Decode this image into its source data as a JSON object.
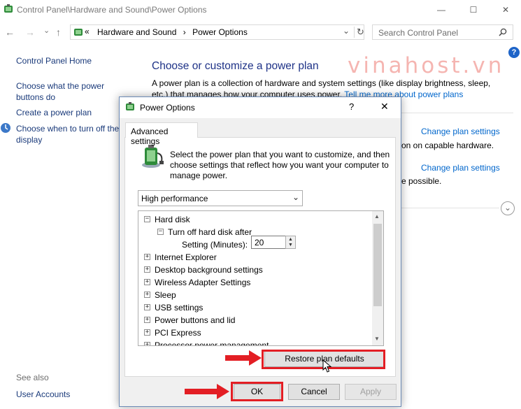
{
  "window": {
    "title": "Control Panel\\Hardware and Sound\\Power Options",
    "minimize_glyph": "—",
    "maximize_glyph": "☐",
    "close_glyph": "✕"
  },
  "nav": {
    "back_glyph": "←",
    "forward_glyph": "→",
    "recent_glyph": "⌄",
    "up_glyph": "↑",
    "overflow_glyph": "«",
    "breadcrumbs": [
      "Hardware and Sound",
      "Power Options"
    ],
    "separator": "›",
    "dropdown_glyph": "⌄",
    "refresh_glyph": "↻",
    "search_placeholder": "Search Control Panel",
    "search_icon": "search-icon"
  },
  "sidebar": {
    "home": "Control Panel Home",
    "links": [
      "Choose what the power buttons do",
      "Create a power plan",
      "Choose when to turn off the display"
    ],
    "see_also": "See also",
    "user_accounts": "User Accounts"
  },
  "main": {
    "title": "Choose or customize a power plan",
    "desc_text": "A power plan is a collection of hardware and system settings (like display brightness, sleep, etc.) that manages how your computer uses power.",
    "desc_link": "Tell me more about power plans",
    "help": "?",
    "change_plan_1": "Change plan settings",
    "text_1": "on on capable hardware.",
    "change_plan_2": "Change plan settings",
    "text_2": "e possible.",
    "expand_glyph": "⌄"
  },
  "watermark": "vinahost.vn",
  "dialog": {
    "title": "Power Options",
    "help": "?",
    "close": "✕",
    "tab": "Advanced settings",
    "instruction": "Select the power plan that you want to customize, and then choose settings that reflect how you want your computer to manage power.",
    "plan_selected": "High performance",
    "dropdown_glyph": "⌄",
    "tree": [
      {
        "label": "Hard disk",
        "expander": "−"
      },
      {
        "label": "Turn off hard disk after",
        "expander": "−"
      },
      {
        "label": "Setting (Minutes):",
        "expander": ""
      },
      {
        "label": "Internet Explorer",
        "expander": "+"
      },
      {
        "label": "Desktop background settings",
        "expander": "+"
      },
      {
        "label": "Wireless Adapter Settings",
        "expander": "+"
      },
      {
        "label": "Sleep",
        "expander": "+"
      },
      {
        "label": "USB settings",
        "expander": "+"
      },
      {
        "label": "Power buttons and lid",
        "expander": "+"
      },
      {
        "label": "PCI Express",
        "expander": "+"
      },
      {
        "label": "Processor power management",
        "expander": "+"
      }
    ],
    "setting_value": "20",
    "scroll_up": "▲",
    "scroll_down": "▼",
    "spin_up": "▲",
    "spin_down": "▼",
    "restore_button": "Restore plan defaults",
    "ok_button": "OK",
    "cancel_button": "Cancel",
    "apply_button": "Apply"
  },
  "colors": {
    "highlight": "#e31e24",
    "link": "#0066cc",
    "title_blue": "#1e3287"
  }
}
